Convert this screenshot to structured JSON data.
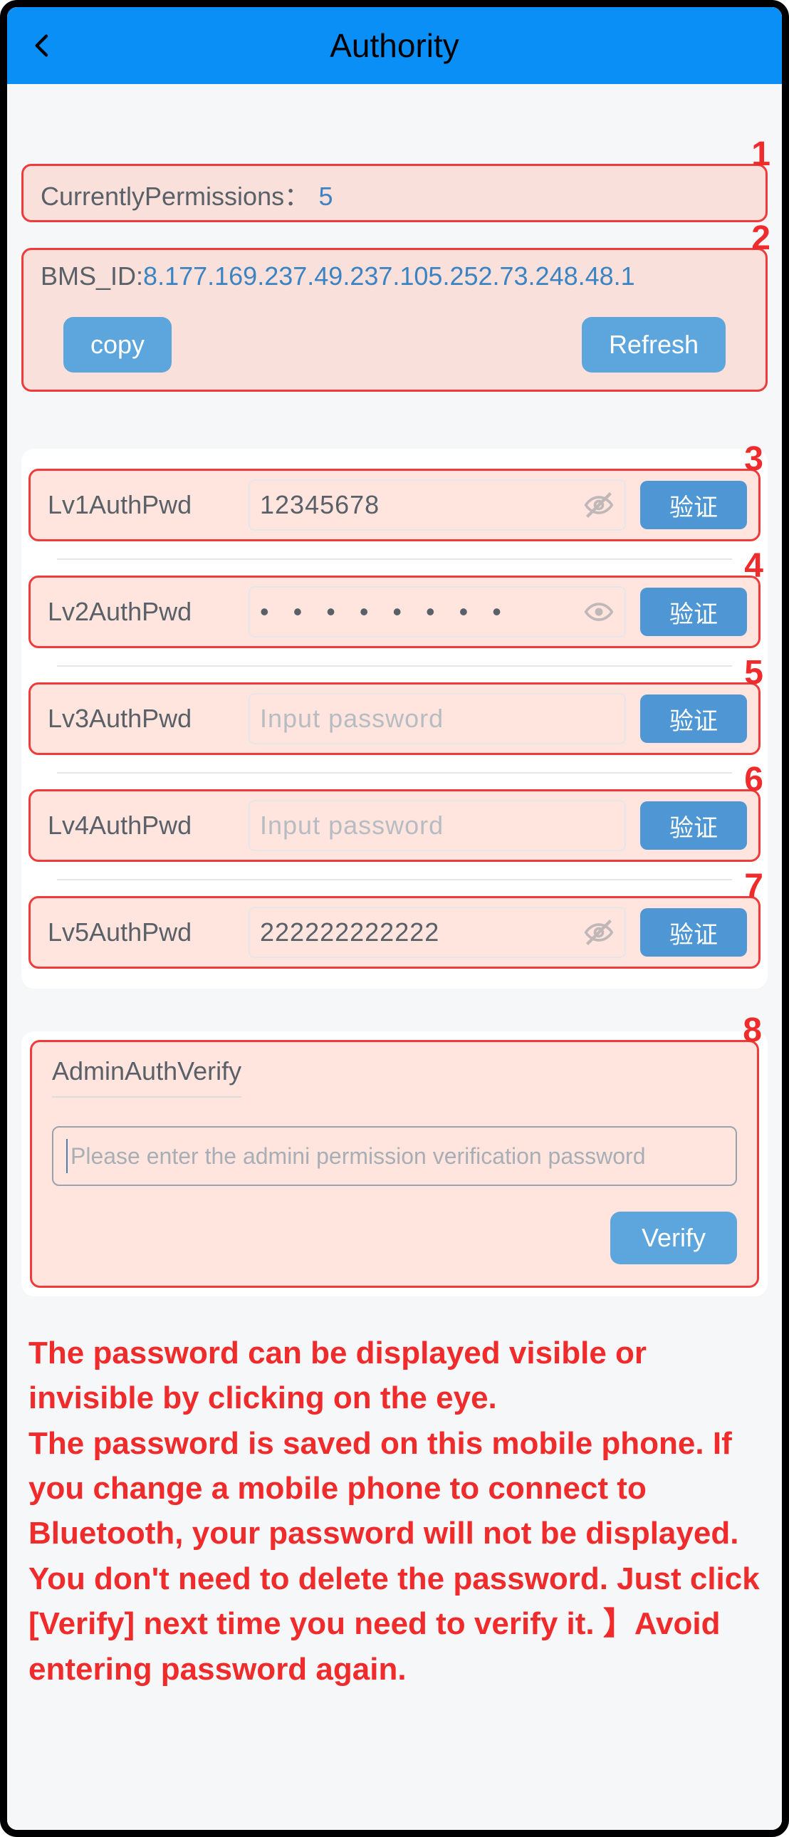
{
  "header": {
    "title": "Authority"
  },
  "permissions": {
    "label": "CurrentlyPermissions：",
    "value": "5"
  },
  "bms": {
    "label": "BMS_ID:",
    "value": "8.177.169.237.49.237.105.252.73.248.48.1",
    "copy": "copy",
    "refresh": "Refresh"
  },
  "pwd_placeholder": "Input password",
  "verify_label": "验证",
  "rows": {
    "lv1": {
      "label": "Lv1AuthPwd",
      "value": "12345678"
    },
    "lv2": {
      "label": "Lv2AuthPwd",
      "masked": "• • • • • • • •"
    },
    "lv3": {
      "label": "Lv3AuthPwd"
    },
    "lv4": {
      "label": "Lv4AuthPwd"
    },
    "lv5": {
      "label": "Lv5AuthPwd",
      "value": "222222222222"
    }
  },
  "admin": {
    "title": "AdminAuthVerify",
    "placeholder": "Please enter the admini permission verification password",
    "verify": "Verify"
  },
  "note": {
    "line1": "The password can be displayed visible or invisible by clicking on the eye.",
    "line2": "The password is saved on this mobile phone. If you change a mobile phone to connect to Bluetooth, your password will not be displayed. You don't need to delete the password. Just click [Verify] next time you need to verify it. 】Avoid entering password again."
  },
  "annotation_numbers": {
    "n1": "1",
    "n2": "2",
    "n3": "3",
    "n4": "4",
    "n5": "5",
    "n6": "6",
    "n7": "7",
    "n8": "8"
  }
}
